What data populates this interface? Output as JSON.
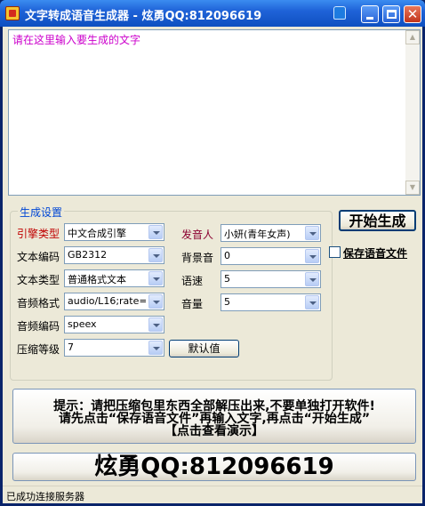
{
  "window": {
    "title": "文字转成语音生成器 - 炫勇QQ:812096619"
  },
  "text_input": {
    "placeholder": "请在这里输入要生成的文字"
  },
  "settings": {
    "group_title": "生成设置",
    "engine_type": {
      "label": "引擎类型",
      "value": "中文合成引擎"
    },
    "text_encoding": {
      "label": "文本编码",
      "value": "GB2312"
    },
    "text_type": {
      "label": "文本类型",
      "value": "普通格式文本"
    },
    "audio_format": {
      "label": "音频格式",
      "value": "audio/L16;rate="
    },
    "audio_codec": {
      "label": "音频编码",
      "value": "speex"
    },
    "compression_level": {
      "label": "压缩等级",
      "value": "7"
    },
    "speaker": {
      "label": "发音人",
      "value": "小妍(青年女声)"
    },
    "background_sound": {
      "label": "背景音",
      "value": "0"
    },
    "speed": {
      "label": "语速",
      "value": "5"
    },
    "volume": {
      "label": "音量",
      "value": "5"
    },
    "default_button": "默认值"
  },
  "actions": {
    "start_button": "开始生成",
    "save_audio_label": "保存语音文件"
  },
  "tip": {
    "line1": "提示：请把压缩包里东西全部解压出来,不要单独打开软件!",
    "line2": "请先点击“保存语音文件”再输入文字,再点击“开始生成”",
    "line3": "【点击查看演示】"
  },
  "banner": {
    "text": "炫勇QQ:812096619"
  },
  "status": {
    "text": "已成功连接服务器"
  }
}
